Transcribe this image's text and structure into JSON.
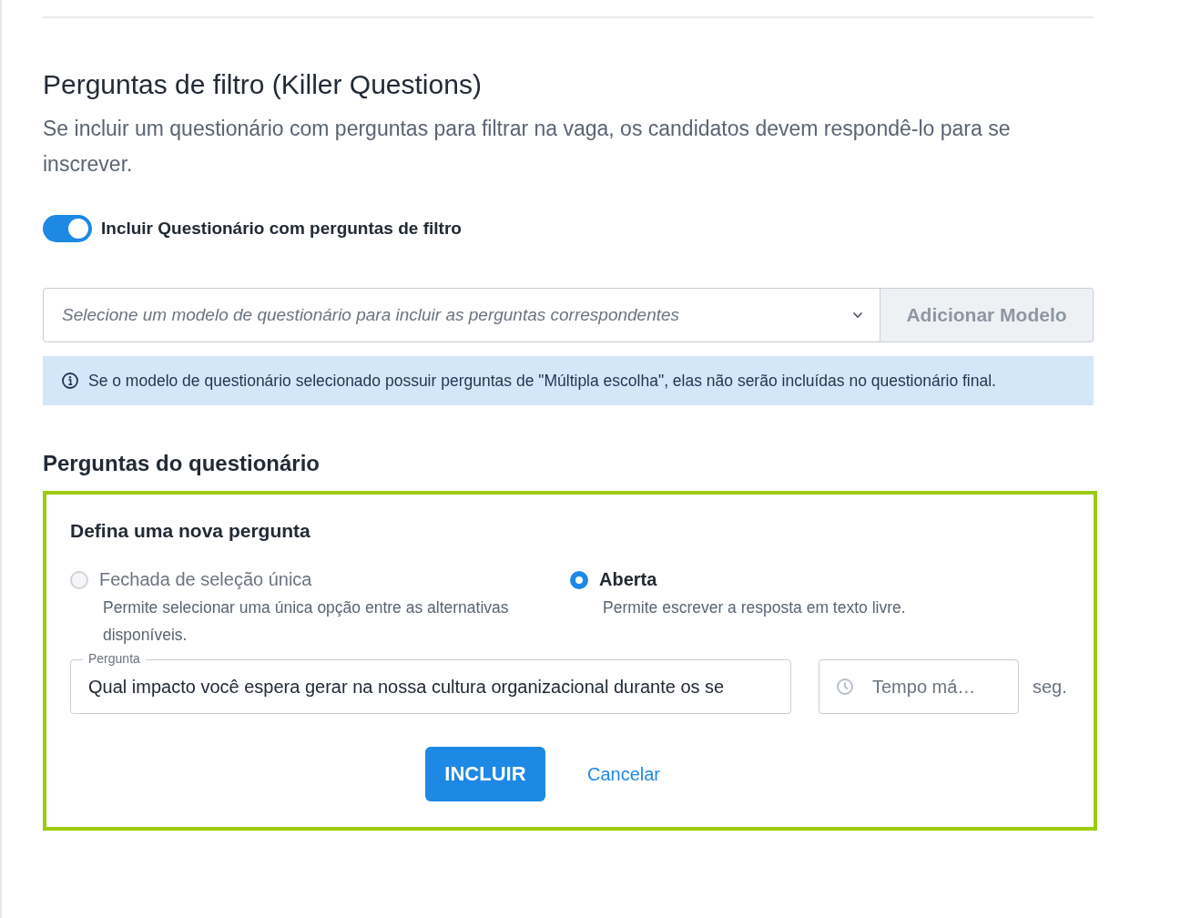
{
  "section": {
    "title": "Perguntas de filtro (Killer Questions)",
    "description": "Se incluir um questionário com perguntas para filtrar na vaga, os candidatos devem respondê-lo para se inscrever."
  },
  "toggle": {
    "label": "Incluir Questionário com perguntas de filtro",
    "on": true
  },
  "template_select": {
    "placeholder": "Selecione um modelo de questionário para incluir as perguntas correspondentes"
  },
  "add_template_button": {
    "label": "Adicionar Modelo",
    "disabled": true
  },
  "info_alert": {
    "text": "Se o modelo de questionário selecionado possuir perguntas de \"Múltipla escolha\", elas não serão incluídas no questionário final."
  },
  "questions_heading": "Perguntas do questionário",
  "new_question": {
    "title": "Defina uma nova pergunta",
    "types": [
      {
        "label": "Fechada de seleção única",
        "description": "Permite selecionar uma única opção entre as alternativas disponíveis.",
        "selected": false
      },
      {
        "label": "Aberta",
        "description": "Permite escrever a resposta em texto livre.",
        "selected": true
      }
    ],
    "question_field": {
      "label": "Pergunta",
      "value": "Qual impacto você espera gerar na nossa cultura organizacional durante os se"
    },
    "time_field": {
      "placeholder": "Tempo má…",
      "unit": "seg."
    },
    "submit_button": "INCLUIR",
    "cancel_link": "Cancelar"
  }
}
